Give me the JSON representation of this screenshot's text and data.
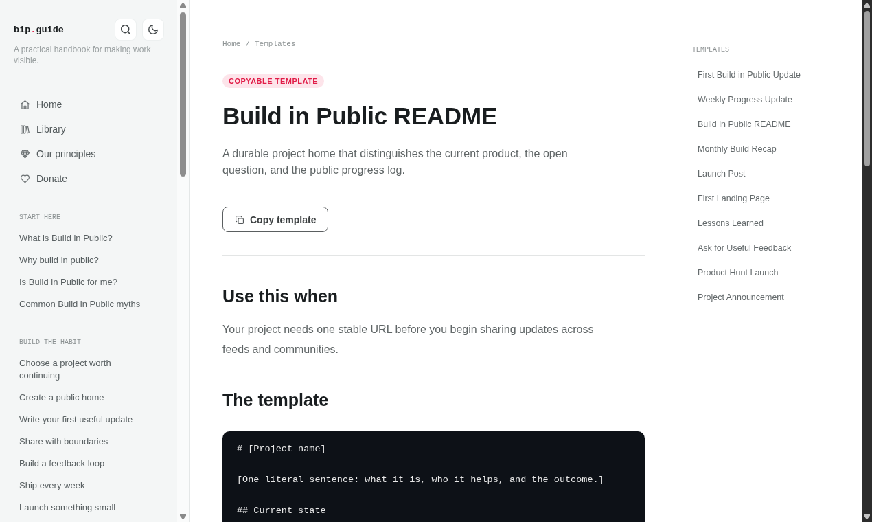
{
  "sidebar": {
    "logo": [
      {
        "text": "bip",
        "accent": false
      },
      {
        "text": ".",
        "accent": true
      },
      {
        "text": "guide",
        "accent": false
      }
    ],
    "tagline": "A practical handbook for making work visible.",
    "nav": [
      "Home",
      "Library",
      "Our principles",
      "Donate"
    ],
    "sections": [
      {
        "title": "START HERE",
        "items": [
          "What is Build in Public?",
          "Why build in public?",
          "Is Build in Public for me?",
          "Common Build in Public myths"
        ]
      },
      {
        "title": "BUILD THE HABIT",
        "items": [
          "Choose a project worth continuing",
          "Create a public home",
          "Write your first useful update",
          "Share with boundaries",
          "Build a feedback loop",
          "Ship every week",
          "Launch something small"
        ]
      }
    ]
  },
  "breadcrumb": {
    "items": [
      "Home",
      "Templates"
    ],
    "separator": "/"
  },
  "article": {
    "badge": "COPYABLE TEMPLATE",
    "title": "Build in Public README",
    "lead": "A durable project home that distinguishes the current product, the open question, and the public progress log.",
    "copy_button": "Copy template",
    "sections": [
      {
        "kind": "text",
        "heading": "Use this when",
        "body": "Your project needs one stable URL before you begin sharing updates across feeds and communities."
      },
      {
        "kind": "code",
        "heading": "The template",
        "lines": [
          "# [Project name]",
          "[One literal sentence: what it is, who it helps, and the outcome.]",
          "## Current state"
        ]
      }
    ]
  },
  "toc": {
    "title": "TEMPLATES",
    "items": [
      "First Build in Public Update",
      "Weekly Progress Update",
      "Build in Public README",
      "Monthly Build Recap",
      "Launch Post",
      "First Landing Page",
      "Lessons Learned",
      "Ask for Useful Feedback",
      "Product Hunt Launch",
      "Project Announcement"
    ]
  }
}
